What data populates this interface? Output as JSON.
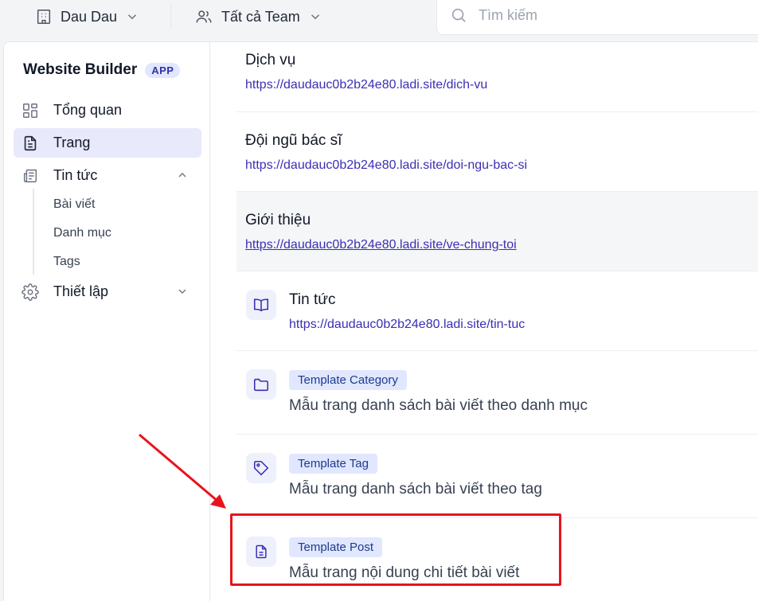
{
  "topbar": {
    "workspace": "Dau Dau",
    "team": "Tất cả Team",
    "search_placeholder": "Tìm kiếm"
  },
  "sidebar": {
    "app_name": "Website Builder",
    "app_badge": "APP",
    "items": [
      {
        "label": "Tổng quan",
        "icon": "dashboard-icon"
      },
      {
        "label": "Trang",
        "icon": "page-icon",
        "active": true
      },
      {
        "label": "Tin tức",
        "icon": "news-icon",
        "expanded": true
      },
      {
        "label": "Thiết lập",
        "icon": "gear-icon"
      }
    ],
    "news_sub": [
      "Bài viết",
      "Danh mục",
      "Tags"
    ]
  },
  "pages": [
    {
      "title": "Dịch vụ",
      "url": "https://daudauc0b2b24e80.ladi.site/dich-vu"
    },
    {
      "title": "Đội ngũ bác sĩ",
      "url": "https://daudauc0b2b24e80.ladi.site/doi-ngu-bac-si"
    },
    {
      "title": "Giới thiệu",
      "url": "https://daudauc0b2b24e80.ladi.site/ve-chung-toi"
    },
    {
      "title": "Tin tức",
      "url": "https://daudauc0b2b24e80.ladi.site/tin-tuc",
      "icon": "book-icon"
    }
  ],
  "templates": [
    {
      "badge": "Template Category",
      "desc": "Mẫu trang danh sách bài viết theo danh mục",
      "icon": "folder-icon"
    },
    {
      "badge": "Template Tag",
      "desc": "Mẫu trang danh sách bài viết theo tag",
      "icon": "tag-icon"
    },
    {
      "badge": "Template Post",
      "desc": "Mẫu trang nội dung chi tiết bài viết",
      "icon": "document-icon"
    }
  ],
  "colors": {
    "accent": "#3b2fb3",
    "annotation": "#e8141c",
    "active_bg": "#e8e9fb"
  }
}
